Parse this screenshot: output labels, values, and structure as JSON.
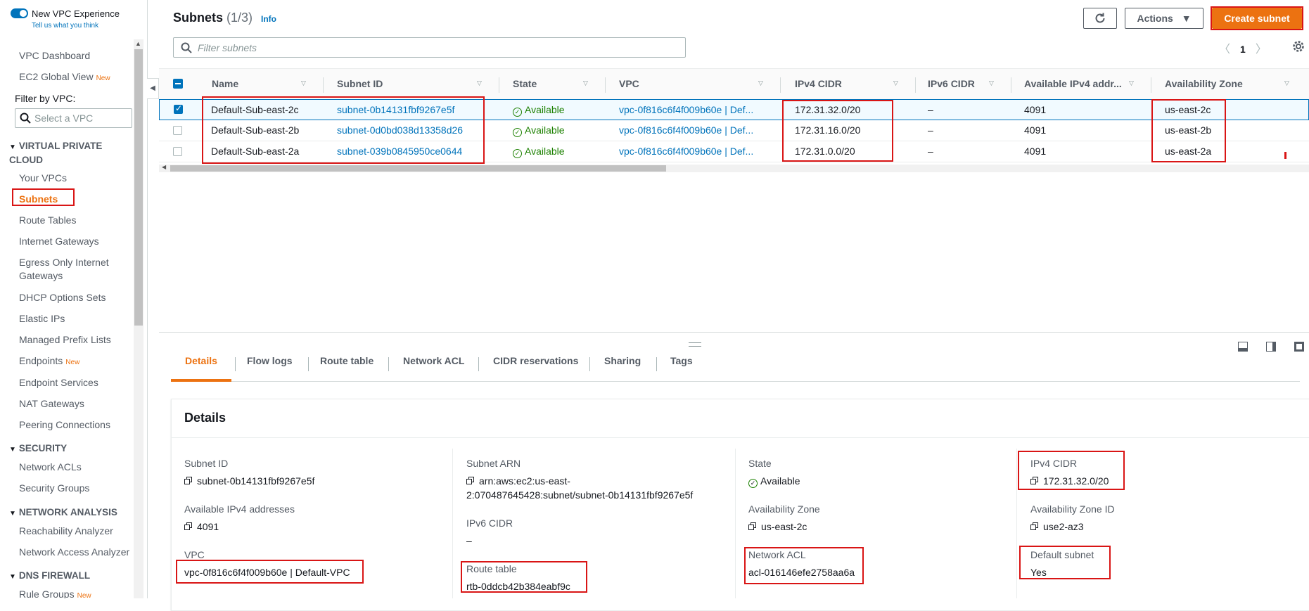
{
  "sidebar": {
    "experience_toggle": "New VPC Experience",
    "feedback_link": "Tell us what you think",
    "vpc_dashboard": "VPC Dashboard",
    "ec2_global_view": "EC2 Global View",
    "new_badge": "New",
    "filter_label": "Filter by VPC:",
    "select_placeholder": "Select a VPC",
    "sections": {
      "vpc": "VIRTUAL PRIVATE CLOUD",
      "security": "SECURITY",
      "network_analysis": "NETWORK ANALYSIS",
      "dns_firewall": "DNS FIREWALL"
    },
    "items": {
      "your_vpcs": "Your VPCs",
      "subnets": "Subnets",
      "route_tables": "Route Tables",
      "internet_gateways": "Internet Gateways",
      "egress_only_1": "Egress Only Internet",
      "egress_only_2": "Gateways",
      "dhcp_options": "DHCP Options Sets",
      "elastic_ips": "Elastic IPs",
      "managed_prefix": "Managed Prefix Lists",
      "endpoints": "Endpoints",
      "endpoint_services": "Endpoint Services",
      "nat_gateways": "NAT Gateways",
      "peering": "Peering Connections",
      "network_acls": "Network ACLs",
      "security_groups": "Security Groups",
      "reachability": "Reachability Analyzer",
      "network_access": "Network Access Analyzer",
      "rule_groups": "Rule Groups"
    }
  },
  "header": {
    "title": "Subnets",
    "count": "(1/3)",
    "info": "Info",
    "actions": "Actions",
    "create": "Create subnet",
    "filter_placeholder": "Filter subnets",
    "page": "1"
  },
  "table": {
    "columns": [
      "Name",
      "Subnet ID",
      "State",
      "VPC",
      "IPv4 CIDR",
      "IPv6 CIDR",
      "Available IPv4 addr...",
      "Availability Zone"
    ],
    "rows": [
      {
        "name": "Default-Sub-east-2c",
        "subnet_id": "subnet-0b14131fbf9267e5f",
        "state": "Available",
        "vpc": "vpc-0f816c6f4f009b60e | Def...",
        "ipv4": "172.31.32.0/20",
        "ipv6": "–",
        "avail": "4091",
        "az": "us-east-2c"
      },
      {
        "name": "Default-Sub-east-2b",
        "subnet_id": "subnet-0d0bd038d13358d26",
        "state": "Available",
        "vpc": "vpc-0f816c6f4f009b60e | Def...",
        "ipv4": "172.31.16.0/20",
        "ipv6": "–",
        "avail": "4091",
        "az": "us-east-2b"
      },
      {
        "name": "Default-Sub-east-2a",
        "subnet_id": "subnet-039b0845950ce0644",
        "state": "Available",
        "vpc": "vpc-0f816c6f4f009b60e | Def...",
        "ipv4": "172.31.0.0/20",
        "ipv6": "–",
        "avail": "4091",
        "az": "us-east-2a"
      }
    ]
  },
  "tabs": [
    "Details",
    "Flow logs",
    "Route table",
    "Network ACL",
    "CIDR reservations",
    "Sharing",
    "Tags"
  ],
  "details": {
    "title": "Details",
    "subnet_id_label": "Subnet ID",
    "subnet_id": "subnet-0b14131fbf9267e5f",
    "avail_label": "Available IPv4 addresses",
    "avail": "4091",
    "vpc_label": "VPC",
    "vpc": "vpc-0f816c6f4f009b60e | Default-VPC",
    "arn_label": "Subnet ARN",
    "arn_1": "arn:aws:ec2:us-east-",
    "arn_2": "2:070487645428:subnet/subnet-0b14131fbf9267e5f",
    "ipv6_label": "IPv6 CIDR",
    "ipv6": "–",
    "route_label": "Route table",
    "route": "rtb-0ddcb42b384eabf9c",
    "state_label": "State",
    "state": "Available",
    "az_label": "Availability Zone",
    "az": "us-east-2c",
    "acl_label": "Network ACL",
    "acl": "acl-016146efe2758aa6a",
    "ipv4_label": "IPv4 CIDR",
    "ipv4": "172.31.32.0/20",
    "azid_label": "Availability Zone ID",
    "azid": "use2-az3",
    "default_label": "Default subnet",
    "default": "Yes"
  },
  "colors": {
    "accent": "#ec7211",
    "link": "#0073bb",
    "success": "#1d8102",
    "highlight": "#d91515"
  }
}
